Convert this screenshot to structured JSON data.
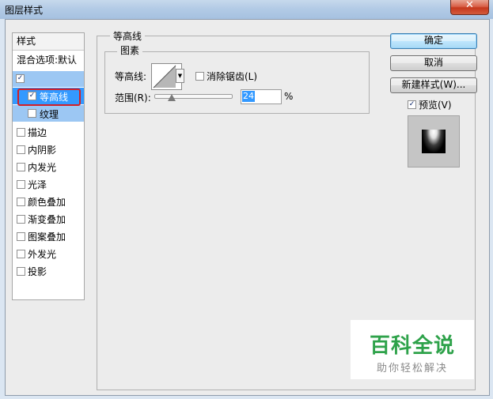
{
  "window": {
    "title": "图层样式",
    "close_glyph": "✕"
  },
  "styles_panel": {
    "header": "样式",
    "blend_options": "混合选项:默认",
    "items": [
      {
        "label": "",
        "checked": true
      },
      {
        "label": "等高线",
        "checked": true,
        "selected": true
      },
      {
        "label": "纹理",
        "checked": false
      },
      {
        "label": "描边",
        "checked": false
      },
      {
        "label": "内阴影",
        "checked": false
      },
      {
        "label": "内发光",
        "checked": false
      },
      {
        "label": "光泽",
        "checked": false
      },
      {
        "label": "颜色叠加",
        "checked": false
      },
      {
        "label": "渐变叠加",
        "checked": false
      },
      {
        "label": "图案叠加",
        "checked": false
      },
      {
        "label": "外发光",
        "checked": false
      },
      {
        "label": "投影",
        "checked": false
      }
    ]
  },
  "contour_panel": {
    "group_title": "等高线",
    "elements_title": "图素",
    "contour_label": "等高线:",
    "antialias_label": "消除锯齿(L)",
    "antialias_checked": false,
    "range_label": "范围(R):",
    "range_value": "24",
    "range_unit": "%"
  },
  "buttons": {
    "ok": "确定",
    "cancel": "取消",
    "new_style": "新建样式(W)..."
  },
  "preview": {
    "label": "预览(V)",
    "checked": true
  },
  "watermark": {
    "main": "百科全说",
    "sub": "助你轻松解决"
  },
  "colors": {
    "selection": "#3399ff",
    "selection_light": "#9cc7f3",
    "highlight_box": "#d21f26",
    "watermark_green": "#2ea24a"
  }
}
